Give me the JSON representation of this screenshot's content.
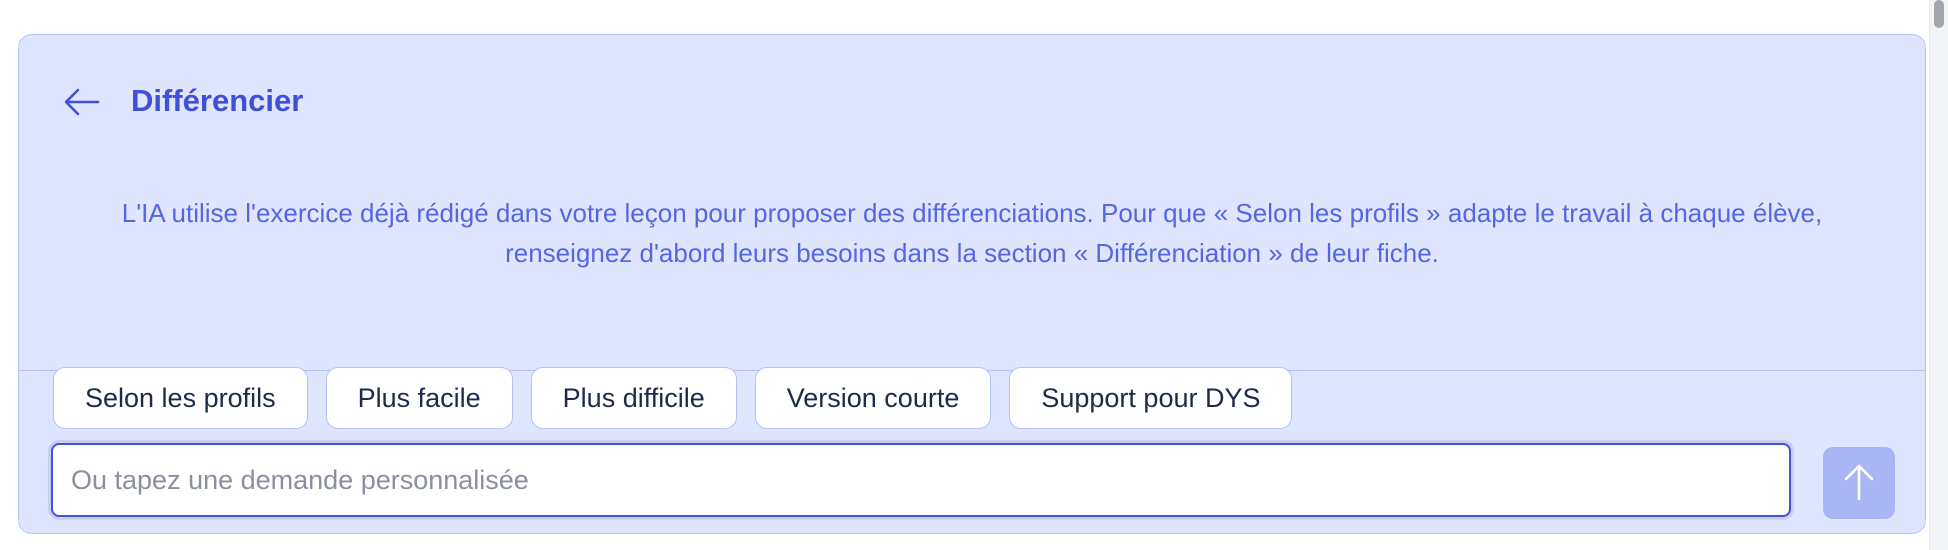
{
  "panel": {
    "title": "Différencier",
    "description": "L'IA utilise l'exercice déjà rédigé dans votre leçon pour proposer des différenciations. Pour que « Selon les profils » adapte le travail à chaque élève, renseignez d'abord leurs besoins dans la section « Différenciation » de leur fiche."
  },
  "chips": [
    {
      "label": "Selon les profils"
    },
    {
      "label": "Plus facile"
    },
    {
      "label": "Plus difficile"
    },
    {
      "label": "Version courte"
    },
    {
      "label": "Support pour DYS"
    }
  ],
  "input": {
    "value": "",
    "placeholder": "Ou tapez une demande personnalisée"
  },
  "icons": {
    "back": "arrow-left-icon",
    "send": "arrow-up-icon"
  },
  "colors": {
    "accent": "#3f4fd6",
    "panel_bg": "#dfe5fd",
    "send_bg": "#a9b5f5"
  }
}
